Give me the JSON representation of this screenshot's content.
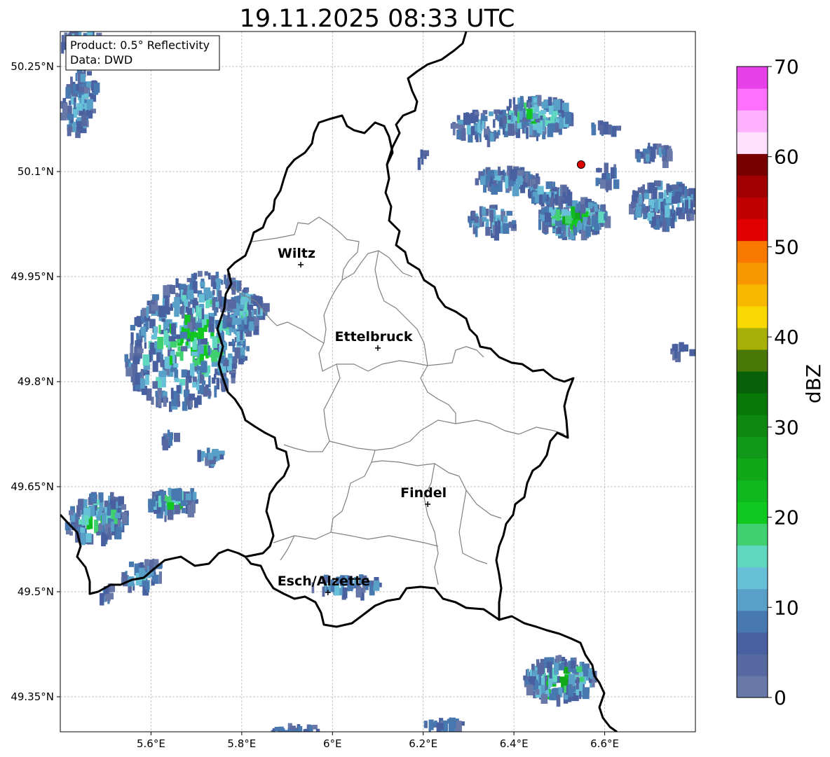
{
  "title": "19.11.2025 08:33 UTC",
  "info_box": {
    "product": "Product: 0.5° Reflectivity",
    "source": "Data: DWD"
  },
  "axes": {
    "lon_range": [
      5.4,
      6.8
    ],
    "lat_range": [
      49.3,
      50.3
    ],
    "lon_ticks": [
      {
        "value": 5.6,
        "label": "5.6°E"
      },
      {
        "value": 5.8,
        "label": "5.8°E"
      },
      {
        "value": 6.0,
        "label": "6°E"
      },
      {
        "value": 6.2,
        "label": "6.2°E"
      },
      {
        "value": 6.4,
        "label": "6.4°E"
      },
      {
        "value": 6.6,
        "label": "6.6°E"
      }
    ],
    "lat_ticks": [
      {
        "value": 50.25,
        "label": "50.25°N"
      },
      {
        "value": 50.1,
        "label": "50.1°N"
      },
      {
        "value": 49.95,
        "label": "49.95°N"
      },
      {
        "value": 49.8,
        "label": "49.8°N"
      },
      {
        "value": 49.65,
        "label": "49.65°N"
      },
      {
        "value": 49.5,
        "label": "49.5°N"
      },
      {
        "value": 49.35,
        "label": "49.35°N"
      }
    ]
  },
  "cities": [
    {
      "name": "Wiltz",
      "lon": 5.93,
      "lat": 49.967
    },
    {
      "name": "Ettelbruck",
      "lon": 6.1,
      "lat": 49.848
    },
    {
      "name": "Findel",
      "lon": 6.21,
      "lat": 49.625
    },
    {
      "name": "Esch/Alzette",
      "lon": 5.99,
      "lat": 49.499
    }
  ],
  "radar_site": {
    "lon": 6.548,
    "lat": 50.11,
    "color": "#e00000"
  },
  "colorbar": {
    "label": "dBZ",
    "min": 0,
    "max": 70,
    "ticks": [
      {
        "value": 0,
        "label": "0"
      },
      {
        "value": 10,
        "label": "10"
      },
      {
        "value": 20,
        "label": "20"
      },
      {
        "value": 30,
        "label": "30"
      },
      {
        "value": 40,
        "label": "40"
      },
      {
        "value": 50,
        "label": "50"
      },
      {
        "value": 60,
        "label": "60"
      },
      {
        "value": 70,
        "label": "70"
      }
    ],
    "colors": [
      "#6878a8",
      "#5868a0",
      "#4860a0",
      "#4878b0",
      "#58a0c8",
      "#68c0d8",
      "#60d8c0",
      "#40d070",
      "#10c820",
      "#10b820",
      "#10a818",
      "#109818",
      "#108810",
      "#087808",
      "#086008",
      "#487808",
      "#a8b008",
      "#f8d800",
      "#f8b800",
      "#f89800",
      "#f87800",
      "#e00000",
      "#c00000",
      "#a00000",
      "#780000",
      "#ffe0ff",
      "#ffb0ff",
      "#ff70ff",
      "#e840e8"
    ]
  }
}
